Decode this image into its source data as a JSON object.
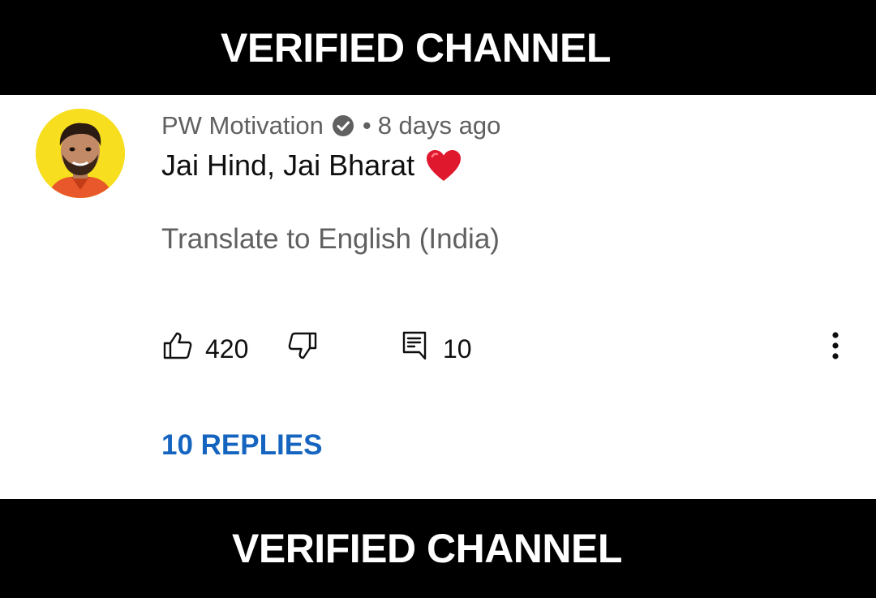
{
  "banner_top": {
    "text": "VERIFIED CHANNEL"
  },
  "banner_bottom": {
    "text": "VERIFIED CHANNEL"
  },
  "comment": {
    "author": "PW Motivation",
    "verified": true,
    "separator": "•",
    "time": "8 days ago",
    "text": "Jai Hind, Jai Bharat",
    "emoji_icon": "red-heart-icon",
    "translate_label": "Translate to English (India)",
    "likes": "420",
    "replies_count": "10",
    "replies_label": "10 REPLIES"
  },
  "icons": {
    "verified": "verified-check-icon",
    "like": "thumbs-up-icon",
    "dislike": "thumbs-down-icon",
    "reply": "comment-icon",
    "more": "more-vertical-icon"
  },
  "colors": {
    "banner_bg": "#000000",
    "banner_text": "#ffffff",
    "card_bg": "#ffffff",
    "meta_text": "#606060",
    "link_blue": "#1565c0",
    "heart_red": "#e0182d",
    "avatar_bg": "#f7de1e"
  }
}
